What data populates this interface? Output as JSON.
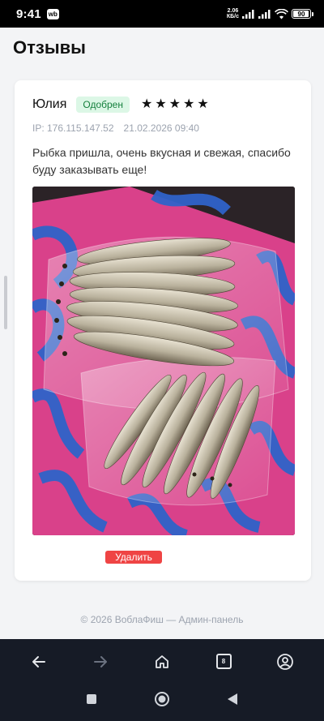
{
  "status_bar": {
    "time": "9:41",
    "app_badge": "wb",
    "net_speed_value": "2.06",
    "net_speed_unit": "КБ/с",
    "battery": "90"
  },
  "page": {
    "title": "Отзывы"
  },
  "review": {
    "author": "Юлия",
    "status": "Одобрен",
    "rating": 5,
    "stars": [
      "★",
      "★",
      "★",
      "★",
      "★"
    ],
    "ip": "IP: 176.115.147.52",
    "date": "21.02.2026 09:40",
    "text": "Рыбка пришла, очень вкусная и свежая, спасибо буду заказывать еще!",
    "delete_label": "Удалить"
  },
  "footer": {
    "text": "© 2026 ВоблаФиш — Админ-панель"
  },
  "browser_nav": {
    "tabs_count": "8"
  },
  "colors": {
    "badge_bg": "#dcf7e6",
    "badge_text": "#15803d",
    "delete_bg": "#ef4444",
    "nav_bg": "#161b26"
  }
}
